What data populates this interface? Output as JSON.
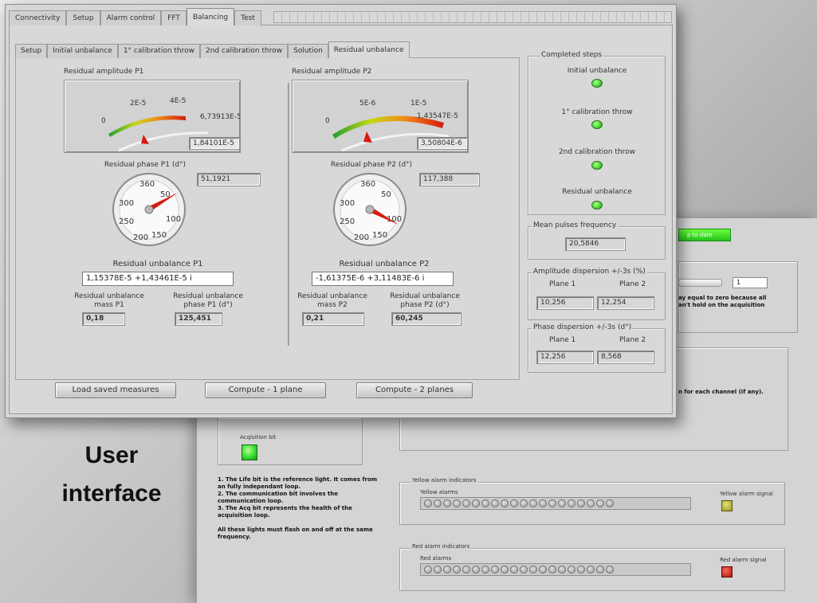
{
  "caption": {
    "line1": "User",
    "line2": "interface"
  },
  "back_window": {
    "up_to_date_label": "p to date",
    "numeric_value": "1",
    "note_line1": "ay equal to zero because all",
    "note_line2": "an't hold on the acquisition",
    "channel_note": "n for each channel (if any).",
    "acq_bit_label": "Acqisition bit",
    "info_lines": [
      "1. The Life bit is the reference light.  It comes from",
      "an fully independant loop.",
      "2. The communication bit involves the",
      "communication loop.",
      "3. The Acq bit represents the health of the",
      "acquisition loop.",
      "",
      "All these lights must flash on and off at the same",
      "frequency."
    ],
    "yellow_group": "Yellow alarm indicators",
    "yellow_alarms": "Yellow alarms",
    "yellow_signal": "Yellow alarm signal",
    "red_group": "Red alarm indicators",
    "red_alarms": "Red alarms",
    "red_signal": "Red alarm signal",
    "alarm_led_count": 20
  },
  "front_window": {
    "tabs": [
      "Connectivity",
      "Setup",
      "Alarm control",
      "FFT",
      "Balancing",
      "Test"
    ],
    "active_tab": 4,
    "inner_tabs": [
      "Setup",
      "Initial unbalance",
      "1° calibration throw",
      "2nd calibration throw",
      "Solution",
      "Residual unbalance"
    ],
    "active_inner_tab": 5,
    "p1": {
      "amp_title": "Residual amplitude P1",
      "gauge_ticks": [
        "0",
        "2E-5",
        "4E-5",
        "6,73913E-5"
      ],
      "gauge_value": "1,84101E-5",
      "phase_title": "Residual phase P1 (d°)",
      "phase_value": "51,1921",
      "dial_ticks": [
        "360",
        "50",
        "100",
        "150",
        "200",
        "250",
        "300"
      ],
      "unbalance_title": "Residual unbalance P1",
      "unbalance_value": "1,15378E-5 +1,43461E-5 i",
      "mass_label": "Residual unbalance mass P1",
      "mass_value": "0,18",
      "phase_label": "Residual unbalance phase P1 (d°)",
      "phase_out": "125,451"
    },
    "p2": {
      "amp_title": "Residual amplitude P2",
      "gauge_ticks": [
        "0",
        "5E-6",
        "1E-5",
        "1,43547E-5"
      ],
      "gauge_value": "3,50804E-6",
      "phase_title": "Residual phase P2 (d°)",
      "phase_value": "117,388",
      "dial_ticks": [
        "360",
        "50",
        "100",
        "150",
        "200",
        "250",
        "300"
      ],
      "unbalance_title": "Residual unbalance P2",
      "unbalance_value": "-1,61375E-6 +3,11483E-6 i",
      "mass_label": "Residual unbalance mass P2",
      "mass_value": "0,21",
      "phase_label": "Residual unbalance phase P2 (d°)",
      "phase_out": "60,245"
    },
    "completed": {
      "title": "Completed steps",
      "steps": [
        "Initial unbalance",
        "1° calibration throw",
        "2nd calibration throw",
        "Residual unbalance"
      ]
    },
    "mean_pulses": {
      "label": "Mean pulses frequency",
      "value": "20,5846"
    },
    "amp_dispersion": {
      "label": "Amplitude dispersion +/-3s (%)",
      "plane1": "Plane 1",
      "plane2": "Plane 2",
      "v1": "10,256",
      "v2": "12,254"
    },
    "phase_dispersion": {
      "label": "Phase dispersion +/-3s (d°)",
      "plane1": "Plane 1",
      "plane2": "Plane 2",
      "v1": "12,256",
      "v2": "8,568"
    },
    "buttons": {
      "load": "Load saved measures",
      "compute1": "Compute -  1 plane",
      "compute2": "Compute  - 2 planes"
    }
  }
}
